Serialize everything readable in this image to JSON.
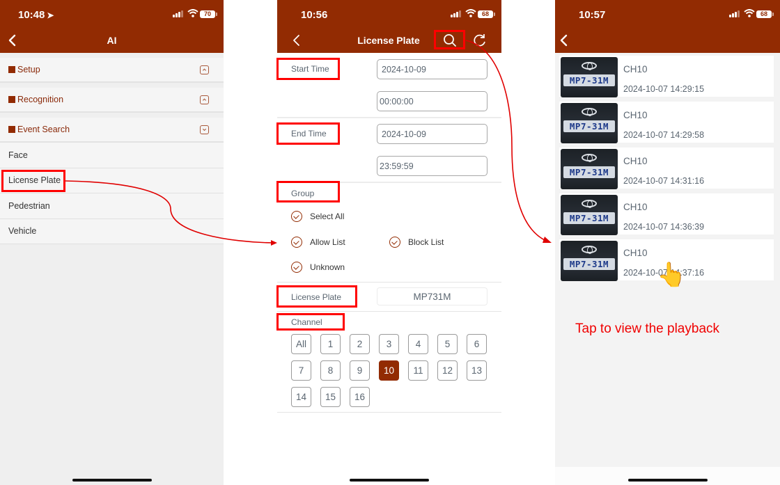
{
  "theme": {
    "brand_color": "#922b02",
    "annotation_color": "#ff0000"
  },
  "screen1": {
    "status": {
      "time": "10:48",
      "battery": "70",
      "location_icon": "location-arrow-icon"
    },
    "nav": {
      "title": "AI",
      "back_icon": "chevron-left-icon"
    },
    "sections": [
      {
        "label": "Setup",
        "state": "collapsed",
        "icon": "chevron-up-icon"
      },
      {
        "label": "Recognition",
        "state": "collapsed",
        "icon": "chevron-up-icon"
      },
      {
        "label": "Event Search",
        "state": "expanded",
        "icon": "chevron-down-icon"
      }
    ],
    "event_search_items": [
      "Face",
      "License Plate",
      "Pedestrian",
      "Vehicle"
    ],
    "highlighted_item": "License Plate"
  },
  "screen2": {
    "status": {
      "time": "10:56",
      "battery": "68"
    },
    "nav": {
      "title": "License Plate",
      "search_icon": "search-icon",
      "refresh_icon": "refresh-icon"
    },
    "start_time": {
      "label": "Start Time",
      "date": "2024-10-09",
      "time": "00:00:00"
    },
    "end_time": {
      "label": "End Time",
      "date": "2024-10-09",
      "time": "23:59:59"
    },
    "group": {
      "label": "Group",
      "options": [
        {
          "label": "Select All",
          "checked": true
        },
        {
          "label": "Allow List",
          "checked": true
        },
        {
          "label": "Block List",
          "checked": true
        },
        {
          "label": "Unknown",
          "checked": true
        }
      ]
    },
    "license_plate": {
      "label": "License Plate",
      "value": "MP731M"
    },
    "channel": {
      "label": "Channel",
      "options": [
        "All",
        "1",
        "2",
        "3",
        "4",
        "5",
        "6",
        "7",
        "8",
        "9",
        "10",
        "11",
        "12",
        "13",
        "14",
        "15",
        "16"
      ],
      "selected": "10"
    }
  },
  "screen3": {
    "status": {
      "time": "10:57",
      "battery": "68"
    },
    "results": [
      {
        "channel": "CH10",
        "timestamp": "2024-10-07 14:29:15",
        "plate": "MP7-31M"
      },
      {
        "channel": "CH10",
        "timestamp": "2024-10-07 14:29:58",
        "plate": "MP7-31M"
      },
      {
        "channel": "CH10",
        "timestamp": "2024-10-07 14:31:16",
        "plate": "MP7-31M"
      },
      {
        "channel": "CH10",
        "timestamp": "2024-10-07 14:36:39",
        "plate": "MP7-31M"
      },
      {
        "channel": "CH10",
        "timestamp": "2024-10-07 14:37:16",
        "plate": "MP7-31M"
      }
    ],
    "hint": "Tap to view the playback",
    "hand_icon": "pointing-hand-icon",
    "hand_glyph": "👆"
  }
}
